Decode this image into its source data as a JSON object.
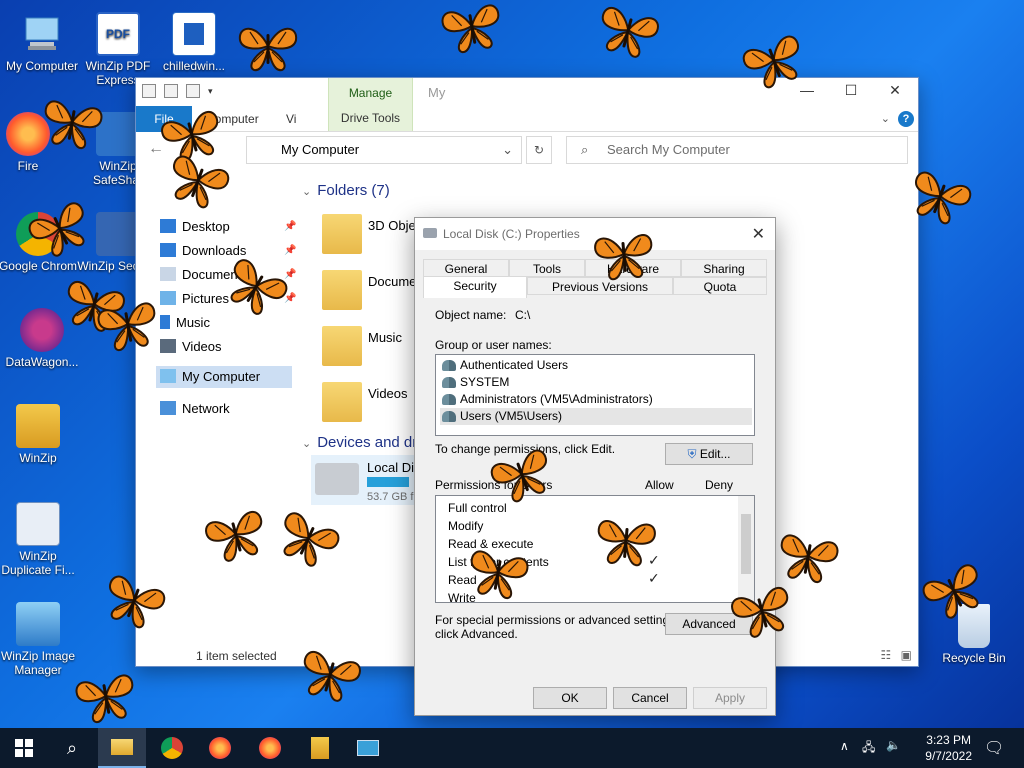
{
  "desktop": {
    "icons": [
      {
        "label": "My Computer",
        "icon": "computer-icon"
      },
      {
        "label": "WinZip PDF Express",
        "icon": "pdf-icon"
      },
      {
        "label": "chilledwin...",
        "icon": "document-icon"
      },
      {
        "label": "Fire",
        "icon": "firefox-icon"
      },
      {
        "label": "WinZip SafeShar",
        "icon": "winzip-safeshare-icon"
      },
      {
        "label": "Google Chrom",
        "icon": "chrome-icon"
      },
      {
        "label": "WinZip Secur...",
        "icon": "winzip-secure-icon"
      },
      {
        "label": "DataWagon...",
        "icon": "datawagon-icon"
      },
      {
        "label": "WinZip",
        "icon": "winzip-icon"
      },
      {
        "label": "WinZip Duplicate Fi...",
        "icon": "winzip-duplicate-icon"
      },
      {
        "label": "WinZip Image Manager",
        "icon": "winzip-image-icon"
      },
      {
        "label": "Recycle Bin",
        "icon": "recycle-bin-icon"
      }
    ]
  },
  "explorer": {
    "title": "My",
    "manage_tab": "Manage",
    "drive_tools_tab": "Drive Tools",
    "file_tab": "File",
    "computer_tab": "Computer",
    "view_tab": "Vi",
    "address": "My Computer",
    "search_placeholder": "Search My Computer",
    "nav": {
      "desktop": "Desktop",
      "downloads": "Downloads",
      "documents": "Documents",
      "pictures": "Pictures",
      "music": "Music",
      "videos": "Videos",
      "my_computer": "My Computer",
      "network": "Network"
    },
    "folders_header": "Folders (7)",
    "folders": [
      "3D Objects",
      "Documents",
      "Music",
      "Videos"
    ],
    "devices_header": "Devices and dr",
    "drive": {
      "name": "Local Dis",
      "size": "53.7 GB fr",
      "used_fraction": 0.35
    },
    "status": "1 item selected"
  },
  "dialog": {
    "title": "Local Disk (C:) Properties",
    "tabs_row1": [
      "General",
      "Tools",
      "Hardware",
      "Sharing"
    ],
    "tabs_row2": [
      "Security",
      "Previous Versions",
      "Quota"
    ],
    "object_name_label": "Object name:",
    "object_name_value": "C:\\",
    "group_label": "Group or user names:",
    "users": [
      "Authenticated Users",
      "SYSTEM",
      "Administrators (VM5\\Administrators)",
      "Users (VM5\\Users)"
    ],
    "change_text": "To change permissions, click Edit.",
    "edit_button": "Edit...",
    "permissions_label": "Permissions for Users",
    "allow_label": "Allow",
    "deny_label": "Deny",
    "permissions": [
      "Full control",
      "Modify",
      "Read & execute",
      "List folder contents",
      "Read",
      "Write"
    ],
    "special_text_1": "For special permissions or advanced settings,",
    "special_text_2": "click Advanced.",
    "advanced_button": "Advanced",
    "ok_button": "OK",
    "cancel_button": "Cancel",
    "apply_button": "Apply"
  },
  "taskbar": {
    "time": "3:23 PM",
    "date": "9/7/2022"
  },
  "colors": {
    "accent": "#1979ca",
    "manage_tab_bg": "#e6f2da",
    "butterfly_orange": "#f08a1c"
  }
}
